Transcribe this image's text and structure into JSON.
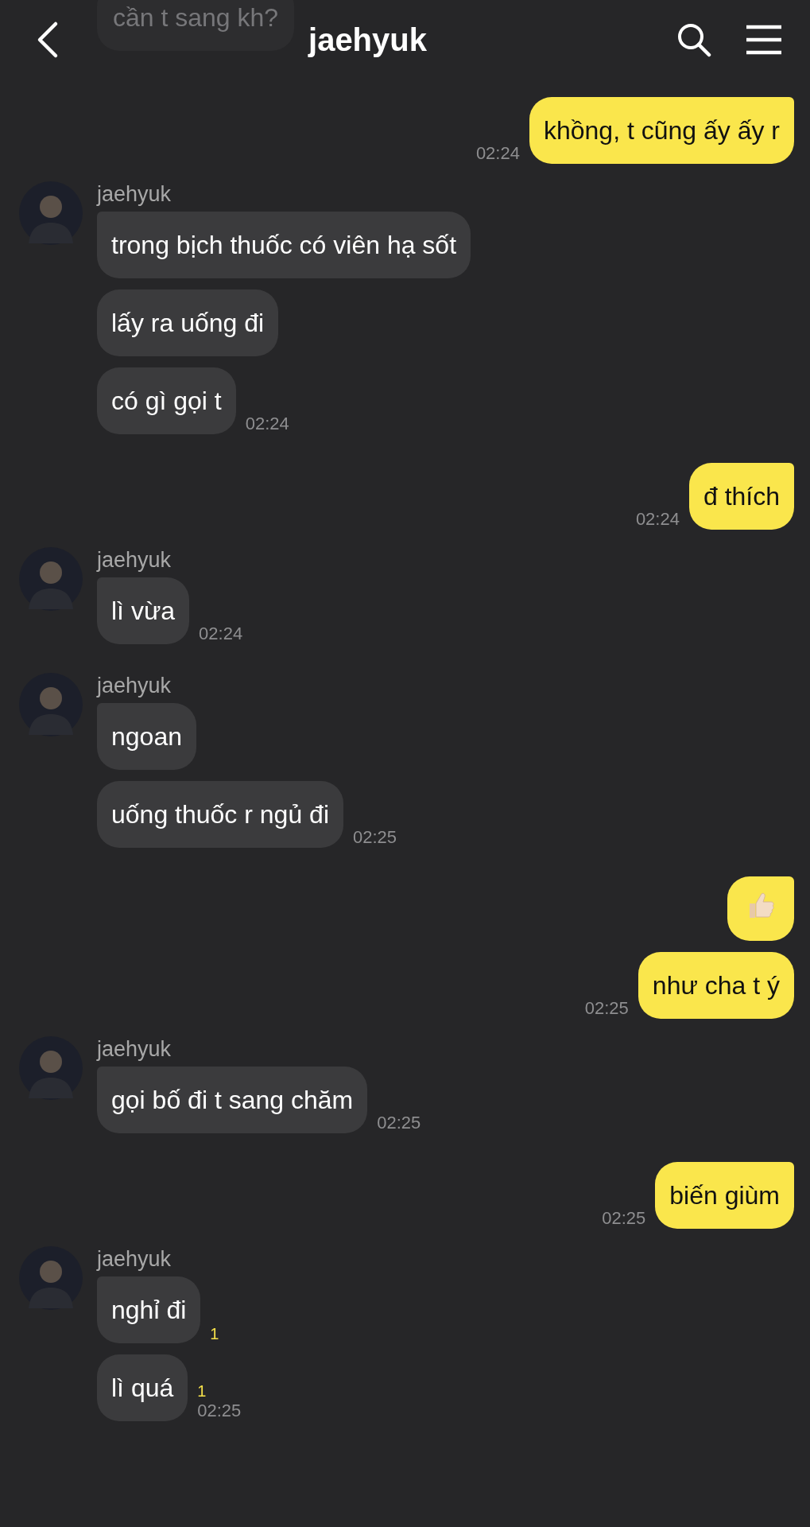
{
  "header": {
    "title": "jaehyuk",
    "faded_message": "cần t sang kh?"
  },
  "messages": [
    {
      "kind": "sent",
      "bubbles": [
        {
          "kind": "text",
          "text": "khồng, t cũng ấy ấy r",
          "time": "02:24"
        }
      ]
    },
    {
      "kind": "received",
      "sender": "jaehyuk",
      "bubbles": [
        {
          "kind": "text",
          "text": "trong bịch thuốc có viên hạ sốt"
        },
        {
          "kind": "text",
          "text": "lấy ra uống đi"
        },
        {
          "kind": "text",
          "text": "có gì gọi t",
          "time": "02:24"
        }
      ]
    },
    {
      "kind": "sent",
      "bubbles": [
        {
          "kind": "text",
          "text": "đ thích",
          "time": "02:24"
        }
      ]
    },
    {
      "kind": "received",
      "sender": "jaehyuk",
      "bubbles": [
        {
          "kind": "text",
          "text": "lì vừa",
          "time": "02:24"
        }
      ]
    },
    {
      "kind": "received",
      "sender": "jaehyuk",
      "bubbles": [
        {
          "kind": "text",
          "text": "ngoan"
        },
        {
          "kind": "text",
          "text": "uống thuốc r ngủ đi",
          "time": "02:25"
        }
      ]
    },
    {
      "kind": "sent",
      "bubbles": [
        {
          "kind": "thumbs-up"
        },
        {
          "kind": "text",
          "text": "như cha t ý",
          "time": "02:25"
        }
      ]
    },
    {
      "kind": "received",
      "sender": "jaehyuk",
      "bubbles": [
        {
          "kind": "text",
          "text": "gọi bố đi t sang chăm",
          "time": "02:25"
        }
      ]
    },
    {
      "kind": "sent",
      "bubbles": [
        {
          "kind": "text",
          "text": "biến giùm",
          "time": "02:25"
        }
      ]
    },
    {
      "kind": "received",
      "sender": "jaehyuk",
      "bubbles": [
        {
          "kind": "text",
          "text": "nghỉ đi",
          "unread": "1"
        },
        {
          "kind": "text",
          "text": "lì quá",
          "unread": "1",
          "time": "02:25"
        }
      ]
    }
  ]
}
